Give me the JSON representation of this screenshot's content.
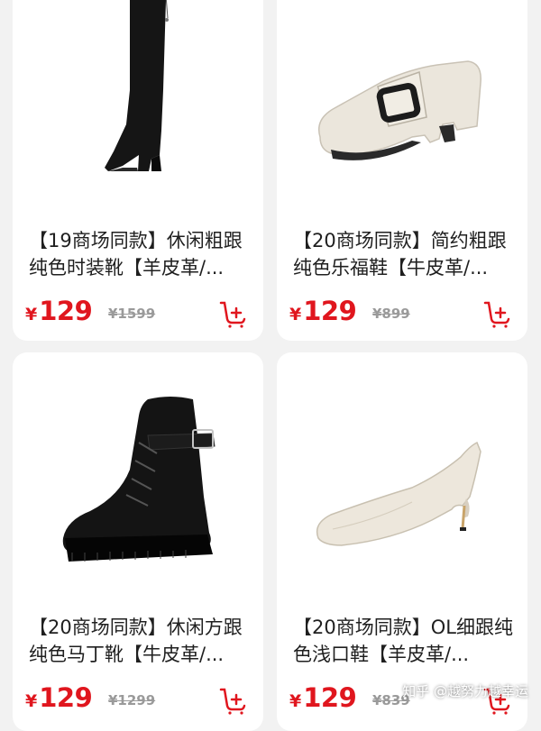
{
  "products": [
    {
      "title": "【19商场同款】休闲粗跟纯色时装靴【羊皮革/...",
      "currency": "¥",
      "price": "129",
      "original_price": "¥1599",
      "image": "black-over-knee-boot"
    },
    {
      "title": "【20商场同款】简约粗跟纯色乐福鞋【牛皮革/...",
      "currency": "¥",
      "price": "129",
      "original_price": "¥899",
      "image": "beige-buckle-loafer"
    },
    {
      "title": "【20商场同款】休闲方跟纯色马丁靴【牛皮革/...",
      "currency": "¥",
      "price": "129",
      "original_price": "¥1299",
      "image": "black-martin-boot"
    },
    {
      "title": "【20商场同款】OL细跟纯色浅口鞋【羊皮革/...",
      "currency": "¥",
      "price": "129",
      "original_price": "¥839",
      "image": "beige-kitten-heel-pump"
    }
  ],
  "watermark": "知乎 @越努力越幸运",
  "colors": {
    "price": "#e0161e",
    "original_price": "#9a9a9a",
    "background": "#f2f2f2"
  },
  "icons": [
    "add-to-cart-icon"
  ]
}
